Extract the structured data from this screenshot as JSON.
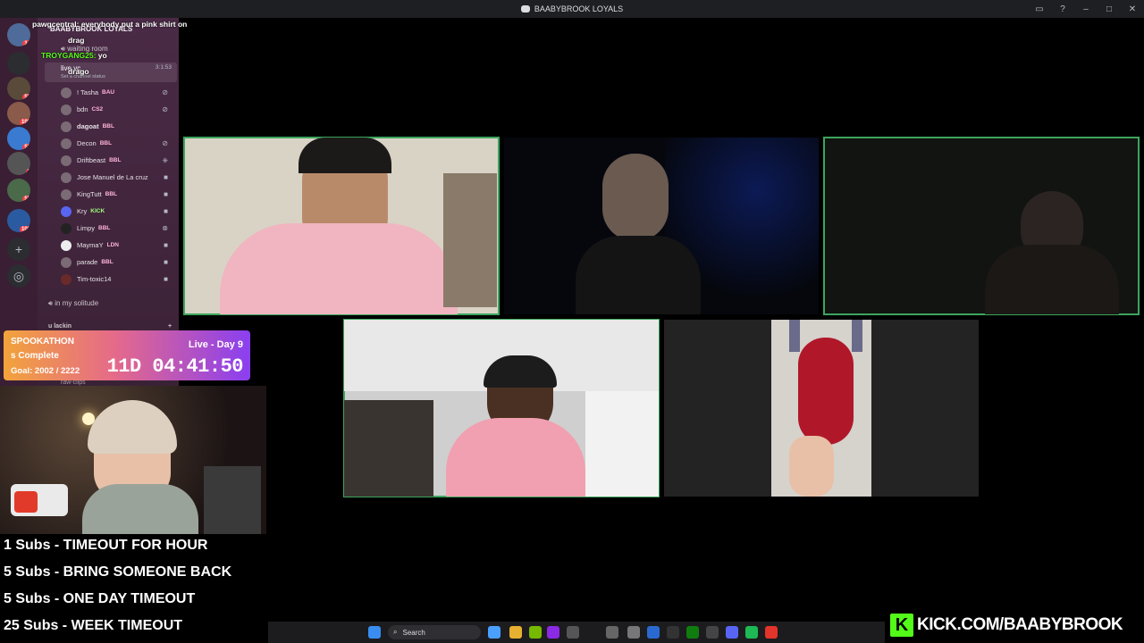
{
  "window": {
    "title": "BAABYBROOK LOYALS",
    "actions": [
      "inbox-icon",
      "help-icon",
      "minimize-icon",
      "maximize-icon",
      "close-icon"
    ]
  },
  "chat_overlay": {
    "messages": [
      {
        "user": "pawgcentral:",
        "text": "everybody put a pink shirt on"
      },
      {
        "user": "",
        "text": "drag"
      },
      {
        "user": "TROYGANG25:",
        "text": "yo"
      },
      {
        "user": "",
        "text": "drago"
      }
    ]
  },
  "guild_sidebar": {
    "badges": [
      "14",
      "58",
      "102",
      "58",
      "7",
      "55",
      "100"
    ]
  },
  "channel_sidebar": {
    "server_name": "BAABYBROOK LOYALS",
    "channels": [
      {
        "name": "waiting room"
      },
      {
        "name": "live vc",
        "time": "3:1:53"
      }
    ],
    "channel_status": "Set a channel status",
    "members": [
      {
        "name": "! Tasha",
        "tag": "BAU"
      },
      {
        "name": "bdn",
        "tag": "CS2"
      },
      {
        "name": "dagoat",
        "tag": "BBL"
      },
      {
        "name": "Decon",
        "tag": "BBL"
      },
      {
        "name": "Driftbeast",
        "tag": "BBL"
      },
      {
        "name": "Jose Manuel de La cruz",
        "tag": ""
      },
      {
        "name": "KingTutt",
        "tag": "BBL"
      },
      {
        "name": "Kry",
        "tag": "KICK"
      },
      {
        "name": "Limpy",
        "tag": "BBL"
      },
      {
        "name": "MaymaY",
        "tag": "LDN"
      },
      {
        "name": "parade",
        "tag": "BBL"
      },
      {
        "name": "Tim-toxic14",
        "tag": ""
      }
    ],
    "channel_solitude": "in my solitude",
    "category": "u lackin",
    "channel_clips": "raw-clips"
  },
  "subathon": {
    "title": "SPOOKATHON",
    "day": "Live - Day 9",
    "status": "s Complete",
    "goal": "Goal: 2002 / 2222",
    "timer": "11D 04:41:50"
  },
  "sub_goals": [
    "1 Subs - TIMEOUT FOR HOUR",
    "5 Subs - BRING SOMEONE BACK",
    "5 Subs - ONE DAY TIMEOUT",
    "25 Subs - WEEK TIMEOUT"
  ],
  "taskbar": {
    "search_placeholder": "Search"
  },
  "kick_banner": {
    "url": "KICK.COM/BAABYBROOK"
  },
  "colors": {
    "speaking": "#3ba55d",
    "kick_green": "#53fc18",
    "sidebar_bg": "#4a2a46"
  }
}
